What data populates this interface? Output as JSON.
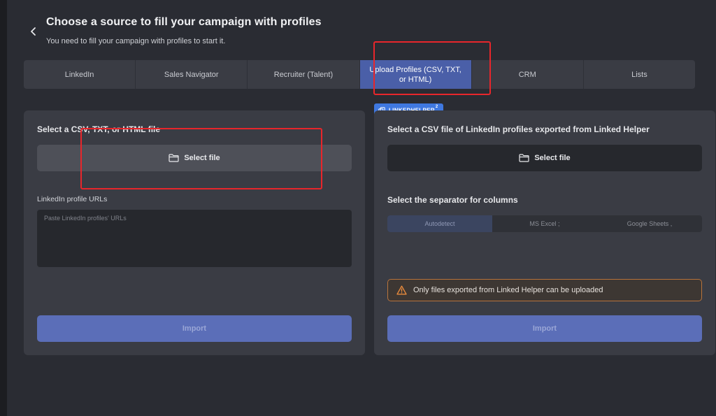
{
  "header": {
    "title": "Choose a source to fill your campaign with profiles",
    "subtitle": "You need to fill your campaign with profiles to start it."
  },
  "tabs": [
    {
      "label": "LinkedIn",
      "active": false
    },
    {
      "label": "Sales Navigator",
      "active": false
    },
    {
      "label": "Recruiter (Talent)",
      "active": false
    },
    {
      "label": "Upload Profiles (CSV, TXT, or HTML)",
      "active": true
    },
    {
      "label": "CRM",
      "active": false
    },
    {
      "label": "Lists",
      "active": false
    }
  ],
  "left_panel": {
    "heading": "Select a CSV, TXT, or HTML file",
    "select_file_label": "Select file",
    "urls_label": "LinkedIn profile URLs",
    "urls_placeholder": "Paste LinkedIn profiles' URLs",
    "import_label": "Import"
  },
  "badge": {
    "label": "LINKEDHELPER",
    "superscript": "2"
  },
  "right_panel": {
    "heading": "Select a CSV file of LinkedIn profiles exported from Linked Helper",
    "select_file_label": "Select file",
    "separator_heading": "Select the separator for columns",
    "separator_options": [
      {
        "label": "Autodetect",
        "active": true
      },
      {
        "label": "MS Excel ;",
        "active": false
      },
      {
        "label": "Google Sheets ,",
        "active": false
      }
    ],
    "warning_text": "Only files exported from Linked Helper can be uploaded",
    "import_label": "Import"
  },
  "colors": {
    "accent": "#4a5fa8",
    "import_button": "#5b6eb8",
    "badge": "#3f78e0",
    "warning_border": "#b8733c",
    "warning_icon": "#e88a3c",
    "annotation": "#e8262b"
  },
  "icons": {
    "back": "chevron-left-icon",
    "file": "folder-icon",
    "badge": "copy-icon",
    "warning": "warning-triangle-icon"
  }
}
